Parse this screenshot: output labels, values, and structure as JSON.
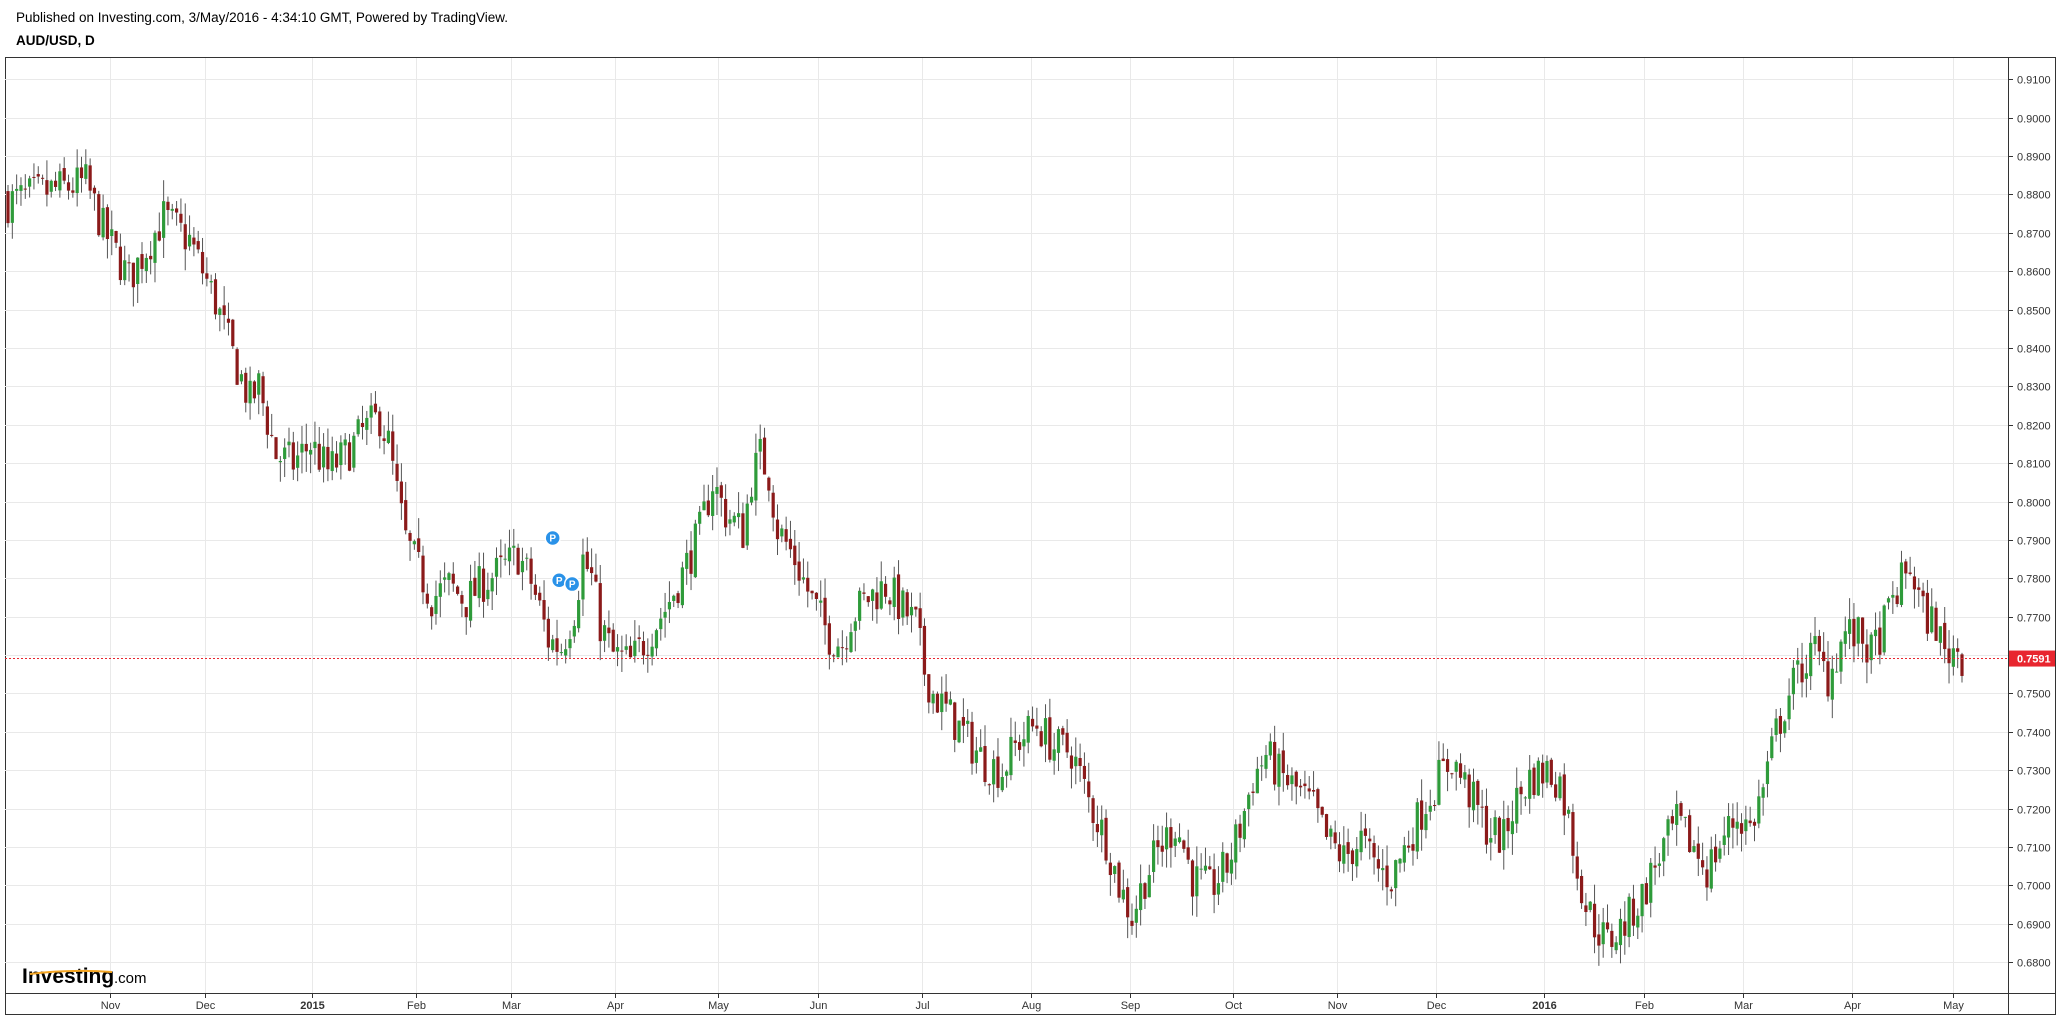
{
  "header": {
    "published_text": "Published on Investing.com, 3/May/2016 - 4:34:10 GMT, Powered by TradingView.",
    "symbol_text": "AUD/USD, D"
  },
  "logo": {
    "main": "Investing",
    "suffix": ".com"
  },
  "colors": {
    "up": "#2e9b3a",
    "down": "#8b1a1a",
    "wick": "#555555",
    "grid": "#e9e9e9",
    "price_line": "#e8262f",
    "marker": "#2a92e8"
  },
  "chart_data": {
    "type": "candlestick",
    "symbol": "AUD/USD",
    "interval": "D",
    "ylim": [
      0.672,
      0.9155
    ],
    "y_ticks": [
      "0.9100",
      "0.9000",
      "0.8900",
      "0.8800",
      "0.8700",
      "0.8600",
      "0.8500",
      "0.8400",
      "0.8300",
      "0.8200",
      "0.8100",
      "0.8000",
      "0.7900",
      "0.7800",
      "0.7700",
      "0.7600",
      "0.7500",
      "0.7400",
      "0.7300",
      "0.7200",
      "0.7100",
      "0.7000",
      "0.6900",
      "0.6800"
    ],
    "x_ticks": [
      {
        "label": "Nov",
        "bold": false
      },
      {
        "label": "Dec",
        "bold": false
      },
      {
        "label": "2015",
        "bold": true
      },
      {
        "label": "Feb",
        "bold": false
      },
      {
        "label": "Mar",
        "bold": false
      },
      {
        "label": "Apr",
        "bold": false
      },
      {
        "label": "May",
        "bold": false
      },
      {
        "label": "Jun",
        "bold": false
      },
      {
        "label": "Jul",
        "bold": false
      },
      {
        "label": "Aug",
        "bold": false
      },
      {
        "label": "Sep",
        "bold": false
      },
      {
        "label": "Oct",
        "bold": false
      },
      {
        "label": "Nov",
        "bold": false
      },
      {
        "label": "Dec",
        "bold": false
      },
      {
        "label": "2016",
        "bold": true
      },
      {
        "label": "Feb",
        "bold": false
      },
      {
        "label": "Mar",
        "bold": false
      },
      {
        "label": "Apr",
        "bold": false
      },
      {
        "label": "May",
        "bold": false
      }
    ],
    "last_price": 0.7591,
    "last_price_label": "0.7591",
    "grid": true,
    "close_path": [
      [
        0,
        0.878
      ],
      [
        10,
        0.881
      ],
      [
        18,
        0.883
      ],
      [
        22,
        0.871
      ],
      [
        28,
        0.858
      ],
      [
        30,
        0.862
      ],
      [
        36,
        0.874
      ],
      [
        42,
        0.868
      ],
      [
        48,
        0.852
      ],
      [
        52,
        0.838
      ],
      [
        56,
        0.826
      ],
      [
        58,
        0.83
      ],
      [
        62,
        0.812
      ],
      [
        66,
        0.81
      ],
      [
        70,
        0.815
      ],
      [
        74,
        0.808
      ],
      [
        78,
        0.812
      ],
      [
        82,
        0.818
      ],
      [
        86,
        0.822
      ],
      [
        88,
        0.815
      ],
      [
        90,
        0.802
      ],
      [
        92,
        0.79
      ],
      [
        95,
        0.782
      ],
      [
        98,
        0.775
      ],
      [
        102,
        0.778
      ],
      [
        106,
        0.774
      ],
      [
        110,
        0.779
      ],
      [
        114,
        0.782
      ],
      [
        118,
        0.786
      ],
      [
        121,
        0.779
      ],
      [
        123,
        0.772
      ],
      [
        125,
        0.764
      ],
      [
        128,
        0.762
      ],
      [
        131,
        0.772
      ],
      [
        133,
        0.785
      ],
      [
        135,
        0.78
      ],
      [
        137,
        0.768
      ],
      [
        140,
        0.76
      ],
      [
        144,
        0.758
      ],
      [
        148,
        0.765
      ],
      [
        152,
        0.772
      ],
      [
        156,
        0.781
      ],
      [
        160,
        0.792
      ],
      [
        163,
        0.805
      ],
      [
        166,
        0.797
      ],
      [
        170,
        0.792
      ],
      [
        172,
        0.806
      ],
      [
        174,
        0.812
      ],
      [
        176,
        0.807
      ],
      [
        178,
        0.793
      ],
      [
        182,
        0.785
      ],
      [
        186,
        0.774
      ],
      [
        190,
        0.765
      ],
      [
        193,
        0.763
      ],
      [
        195,
        0.77
      ],
      [
        199,
        0.775
      ],
      [
        203,
        0.778
      ],
      [
        207,
        0.772
      ],
      [
        210,
        0.768
      ],
      [
        212,
        0.756
      ],
      [
        214,
        0.75
      ],
      [
        218,
        0.744
      ],
      [
        222,
        0.738
      ],
      [
        226,
        0.732
      ],
      [
        230,
        0.73
      ],
      [
        234,
        0.738
      ],
      [
        238,
        0.742
      ],
      [
        242,
        0.736
      ],
      [
        246,
        0.735
      ],
      [
        250,
        0.722
      ],
      [
        254,
        0.712
      ],
      [
        257,
        0.7
      ],
      [
        260,
        0.692
      ],
      [
        263,
        0.702
      ],
      [
        266,
        0.709
      ],
      [
        270,
        0.716
      ],
      [
        272,
        0.71
      ],
      [
        274,
        0.702
      ],
      [
        278,
        0.699
      ],
      [
        282,
        0.705
      ],
      [
        285,
        0.715
      ],
      [
        288,
        0.728
      ],
      [
        291,
        0.734
      ],
      [
        294,
        0.729
      ],
      [
        298,
        0.725
      ],
      [
        302,
        0.72
      ],
      [
        305,
        0.712
      ],
      [
        309,
        0.707
      ],
      [
        313,
        0.712
      ],
      [
        316,
        0.705
      ],
      [
        320,
        0.702
      ],
      [
        324,
        0.712
      ],
      [
        328,
        0.722
      ],
      [
        331,
        0.728
      ],
      [
        334,
        0.733
      ],
      [
        338,
        0.724
      ],
      [
        342,
        0.715
      ],
      [
        346,
        0.712
      ],
      [
        348,
        0.72
      ],
      [
        352,
        0.728
      ],
      [
        356,
        0.73
      ],
      [
        359,
        0.727
      ],
      [
        361,
        0.717
      ],
      [
        363,
        0.705
      ],
      [
        365,
        0.695
      ],
      [
        367,
        0.69
      ],
      [
        370,
        0.685
      ],
      [
        374,
        0.69
      ],
      [
        378,
        0.697
      ],
      [
        382,
        0.708
      ],
      [
        386,
        0.716
      ],
      [
        390,
        0.71
      ],
      [
        393,
        0.704
      ],
      [
        397,
        0.713
      ],
      [
        400,
        0.718
      ],
      [
        403,
        0.715
      ],
      [
        406,
        0.725
      ],
      [
        409,
        0.74
      ],
      [
        412,
        0.75
      ],
      [
        415,
        0.757
      ],
      [
        418,
        0.761
      ],
      [
        421,
        0.754
      ],
      [
        425,
        0.766
      ],
      [
        429,
        0.764
      ],
      [
        431,
        0.76
      ],
      [
        434,
        0.768
      ],
      [
        437,
        0.777
      ],
      [
        440,
        0.783
      ],
      [
        443,
        0.771
      ],
      [
        446,
        0.768
      ],
      [
        448,
        0.76
      ],
      [
        450,
        0.762
      ],
      [
        452,
        0.76
      ]
    ],
    "markers": [
      {
        "label": "P",
        "x": 126,
        "price": 0.7905
      },
      {
        "label": "P",
        "x": 127.5,
        "price": 0.7795
      },
      {
        "label": "P",
        "x": 130.5,
        "price": 0.7785
      }
    ]
  }
}
